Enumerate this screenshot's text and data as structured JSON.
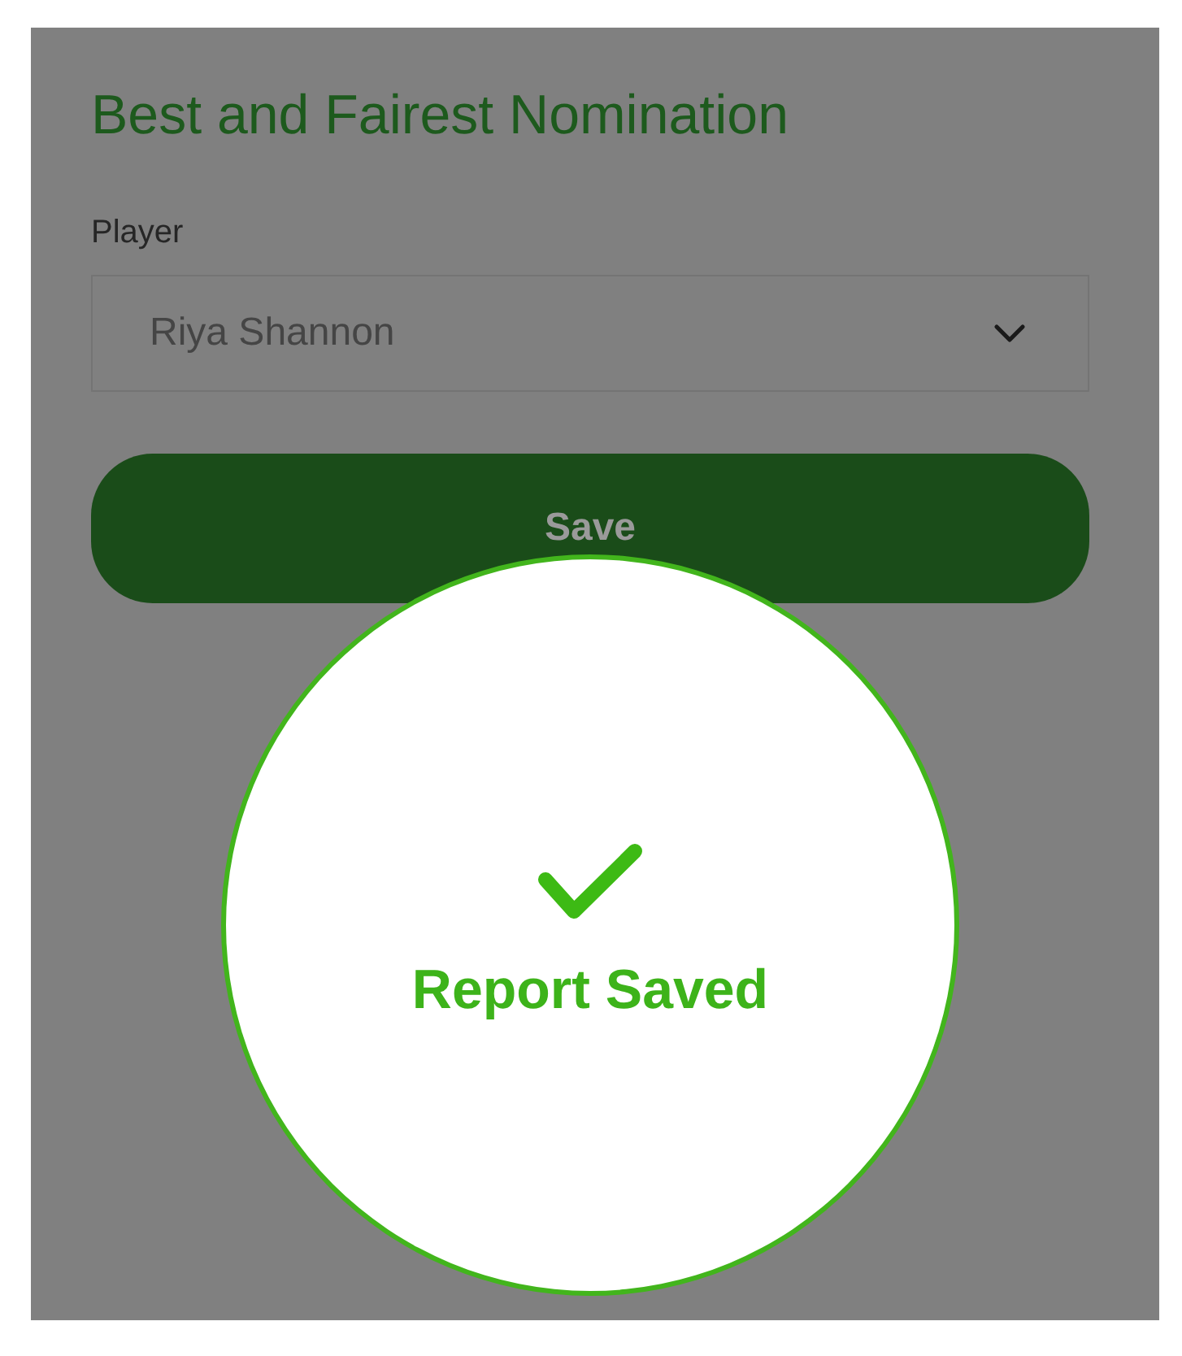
{
  "form": {
    "title": "Best and Fairest Nomination",
    "player_field": {
      "label": "Player",
      "value": "Riya Shannon"
    },
    "save_button": {
      "label": "Save"
    }
  },
  "toast": {
    "message": "Report Saved"
  }
}
